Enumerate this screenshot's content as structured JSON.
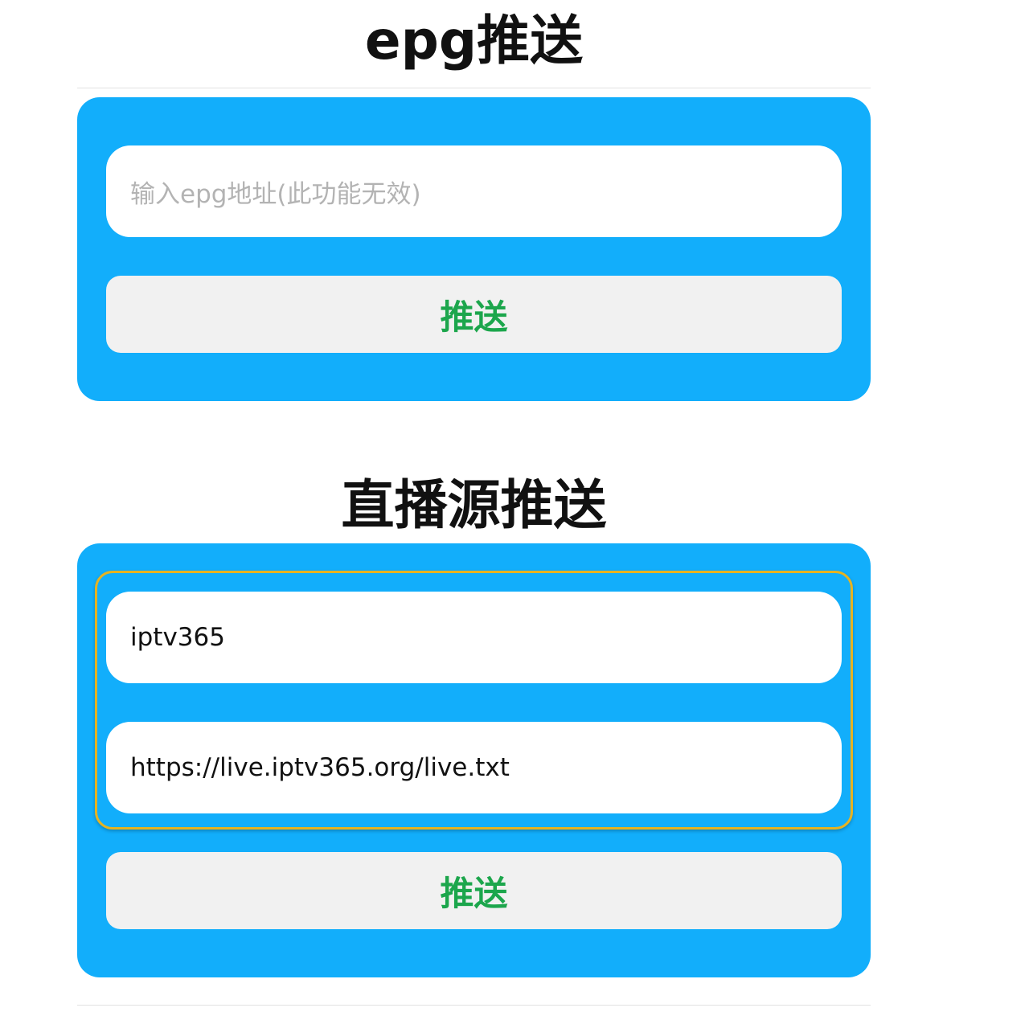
{
  "epg_section": {
    "title": "epg推送",
    "url_placeholder": "输入epg地址(此功能无效)",
    "push_label": "推送"
  },
  "live_section": {
    "title": "直播源推送",
    "name_value": "iptv365",
    "url_value": "https://live.iptv365.org/live.txt",
    "push_label": "推送"
  },
  "colors": {
    "panel": "#12aefb",
    "button_text": "#1ca64c",
    "focus_ring": "#e6b321"
  }
}
